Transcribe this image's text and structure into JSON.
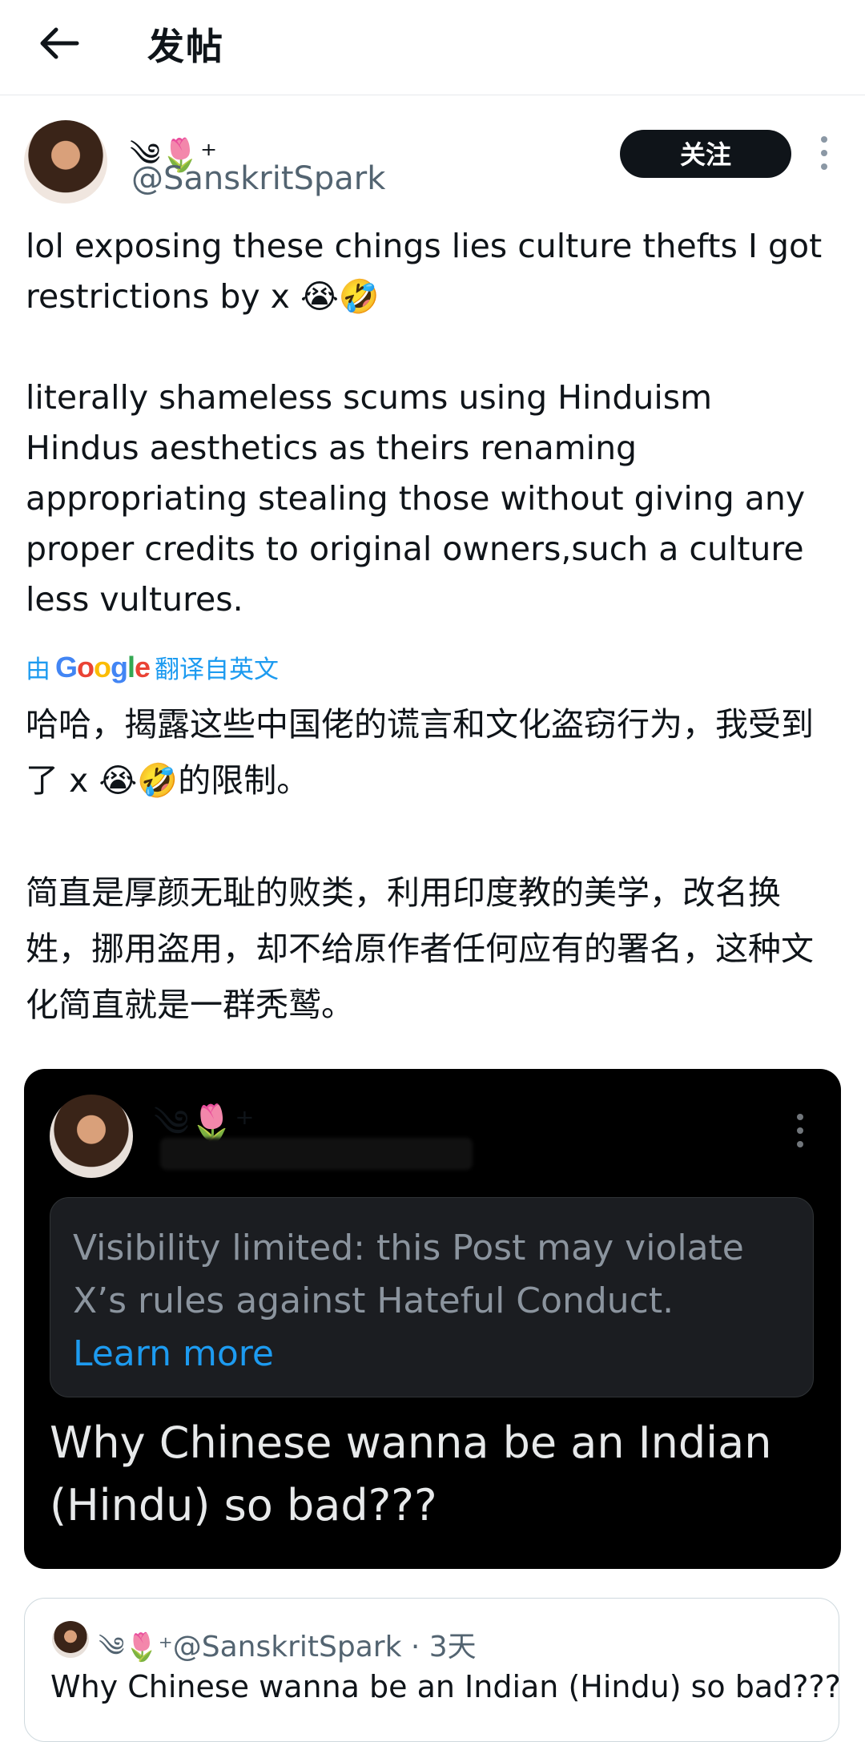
{
  "header": {
    "title": "发帖",
    "back_icon": "arrow-left-icon"
  },
  "author": {
    "display_name_emoji": "༄🌷⁺",
    "handle": "@SanskritSpark",
    "follow_label": "关注"
  },
  "post": {
    "text_en": "lol exposing these chings lies culture thefts I got restrictions by x 😭🤣\n\nliterally shameless scums using Hinduism Hindus aesthetics as theirs renaming appropriating stealing those without giving any proper credits to original owners,such a culture less vultures.",
    "translate_prefix": "由",
    "translate_brand": "Google",
    "translate_suffix": "翻译自英文",
    "text_zh": "哈哈，揭露这些中国佬的谎言和文化盗窃行为，我受到了 x 😭🤣的限制。\n\n简直是厚颜无耻的败类，利用印度教的美学，改名换姓，挪用盗用，却不给原作者任何应有的署名，这种文化简直就是一群秃鹫。"
  },
  "media": {
    "flower": "༄🌷⁺",
    "notice": "Visibility limited: this Post may violate X’s rules against Hateful Conduct.",
    "learn_more": "Learn more",
    "text": "Why Chinese wanna be an Indian (Hindu) so bad???"
  },
  "quote": {
    "flower": "༄🌷⁺",
    "handle": "@SanskritSpark",
    "sep": " · ",
    "time": "3天",
    "text": "Why Chinese wanna be an Indian (Hindu) so bad???"
  },
  "colors": {
    "accent": "#1d9bf0",
    "text": "#0f1419",
    "muted": "#536471"
  }
}
